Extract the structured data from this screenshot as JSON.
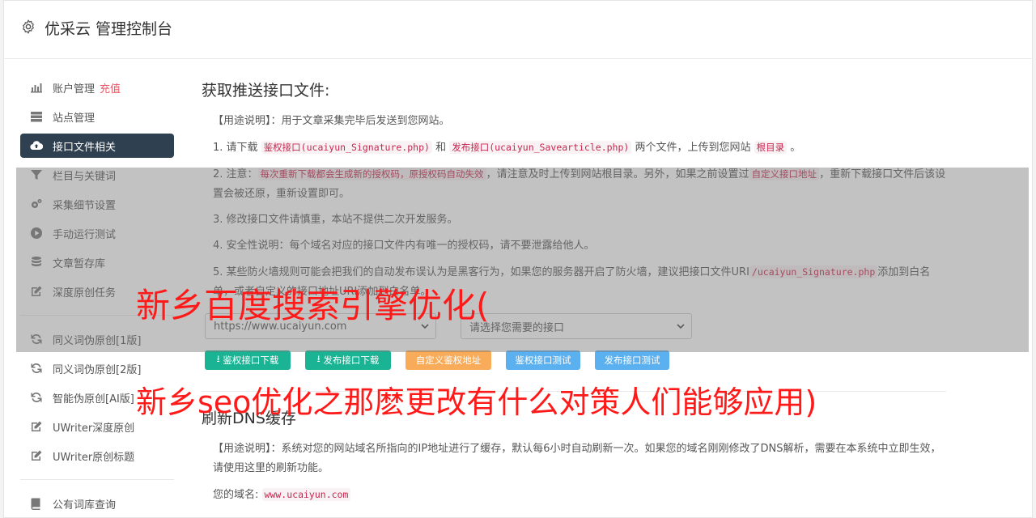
{
  "header": {
    "title": "优采云 管理控制台",
    "icon": "gear-icon"
  },
  "sidebar": {
    "group1": [
      {
        "label": "账户管理",
        "badge": "充值",
        "icon": "bar-chart-icon"
      },
      {
        "label": "站点管理",
        "icon": "server-icon"
      },
      {
        "label": "接口文件相关",
        "icon": "cloud-upload-icon",
        "active": true
      },
      {
        "label": "栏目与关键词",
        "icon": "filter-icon"
      },
      {
        "label": "采集细节设置",
        "icon": "cogs-icon"
      },
      {
        "label": "手动运行测试",
        "icon": "play-circle-icon"
      },
      {
        "label": "文章暂存库",
        "icon": "database-icon"
      },
      {
        "label": "深度原创任务",
        "icon": "edit-icon"
      }
    ],
    "group2": [
      {
        "label": "同义词伪原创[1版]",
        "icon": "refresh-icon"
      },
      {
        "label": "同义词伪原创[2版]",
        "icon": "refresh-icon"
      },
      {
        "label": "智能伪原创[AI版]",
        "icon": "refresh-icon"
      },
      {
        "label": "UWriter深度原创",
        "icon": "edit-icon"
      },
      {
        "label": "UWriter原创标题",
        "icon": "edit-icon"
      }
    ],
    "group3": [
      {
        "label": "公有词库查询",
        "icon": "book-icon"
      }
    ]
  },
  "section1": {
    "title": "获取推送接口文件:",
    "usage_label": "【用途说明】",
    "usage_text": "：用于文章采集完毕后发送到您网站。",
    "p1_a": "1. 请下载",
    "p1_code1": "鉴权接口(ucaiyun_Signature.php)",
    "p1_b": "和",
    "p1_code2": "发布接口(ucaiyun_Savearticle.php)",
    "p1_c": "两个文件，上传到您网站",
    "p1_code3": "根目录",
    "p1_d": "。",
    "p2_a": "2. 注意：",
    "p2_code1": "每次重新下载都会生成新的授权码，原授权码自动失效",
    "p2_b": "，请注意及时上传到网站根目录。另外，如果之前设置过",
    "p2_code2": "自定义接口地址",
    "p2_c": "，重新下载接口文件后该设置会被还原，重新设置即可。",
    "p3": "3. 修改接口文件请慎重，本站不提供二次开发服务。",
    "p4": "4. 安全性说明：每个域名对应的接口文件内有唯一的授权码，请不要泄露给他人。",
    "p5_a": "5. 某些防火墙规则可能会把我们的自动发布误认为是黑客行为，如果您的服务器开启了防火墙，建议把接口文件URI",
    "p5_code": "/ucaiyun_Signature.php",
    "p5_b": "添加到白名单，或者自定义的接口地址URI添加到白名单。",
    "select1": "https://www.ucaiyun.com",
    "select2": "请选择您需要的接口",
    "btn1": "鉴权接口下载",
    "btn2": "发布接口下载",
    "btn3": "自定义鉴权地址",
    "btn4": "鉴权接口测试",
    "btn5": "发布接口测试"
  },
  "section2": {
    "title": "刷新DNS缓存",
    "usage_label": "【用途说明】",
    "usage_text": "：系统对您的网站域名所指向的IP地址进行了缓存，默认每6小时自动刷新一次。如果您的域名刚刚修改了DNS解析，需要在本系统中立即生效，请使用这里的刷新功能。",
    "domain_label": "您的域名:",
    "domain_value": "www.ucaiyun.com"
  },
  "overlay": {
    "line1": "新乡百度搜索引擎优化(",
    "line2": "新乡seo优化之那麽更改有什么对策人们能够应用)"
  }
}
